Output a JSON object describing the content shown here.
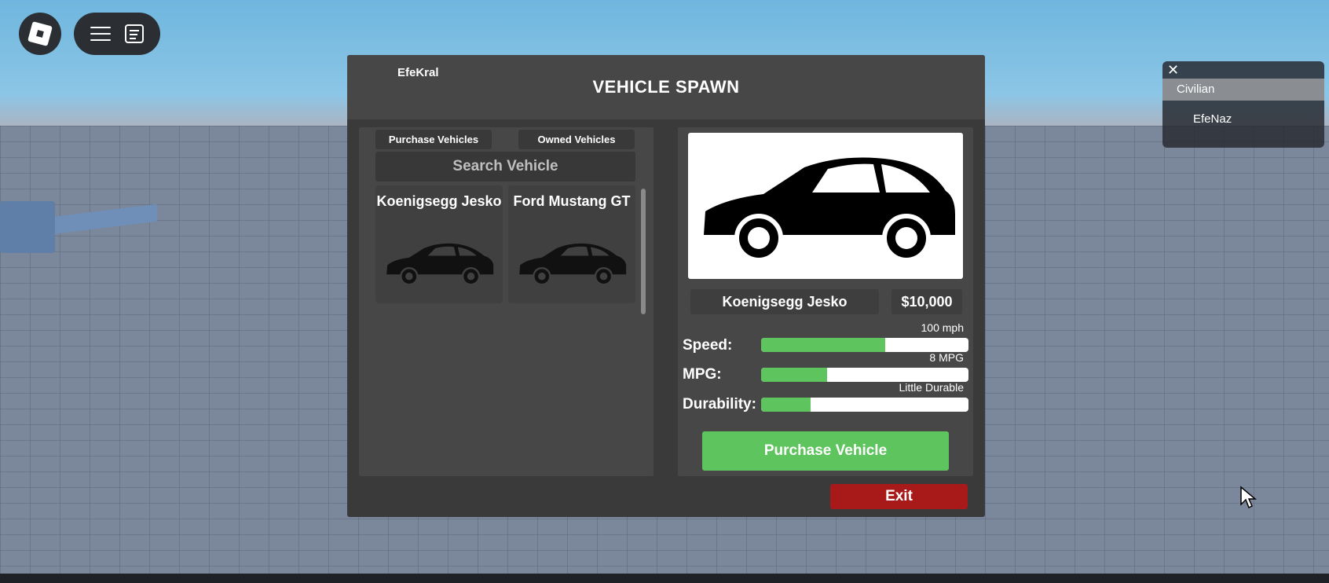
{
  "topbar": {
    "roblox_icon": "roblox-logo-icon",
    "menu_icon": "hamburger-menu-icon",
    "chat_icon": "chat-icon"
  },
  "team_panel": {
    "close_icon": "close-icon",
    "close_glyph": "✕",
    "team_name": "Civilian",
    "player": "EfeNaz"
  },
  "modal": {
    "player_name": "EfeKral",
    "title": "VEHICLE SPAWN",
    "tabs": [
      {
        "label": "Purchase Vehicles"
      },
      {
        "label": "Owned Vehicles"
      }
    ],
    "search_placeholder": "Search Vehicle",
    "vehicles": [
      {
        "name": "Koenigsegg Jesko",
        "icon": "car-silhouette-icon"
      },
      {
        "name": "Ford Mustang GT",
        "icon": "car-silhouette-icon"
      }
    ],
    "selected": {
      "name": "Koenigsegg Jesko",
      "price": "$10,000",
      "stats": [
        {
          "label": "Speed:",
          "value": "100 mph",
          "fill": 0.6
        },
        {
          "label": "MPG:",
          "value": "8 MPG",
          "fill": 0.32
        },
        {
          "label": "Durability:",
          "value": "Little Durable",
          "fill": 0.24
        }
      ]
    },
    "purchase_label": "Purchase Vehicle",
    "exit_label": "Exit"
  },
  "colors": {
    "accent_green": "#5ec45e",
    "exit_red": "#a81a1a",
    "panel_dark": "#3a3a3a",
    "panel_mid": "#474747"
  }
}
